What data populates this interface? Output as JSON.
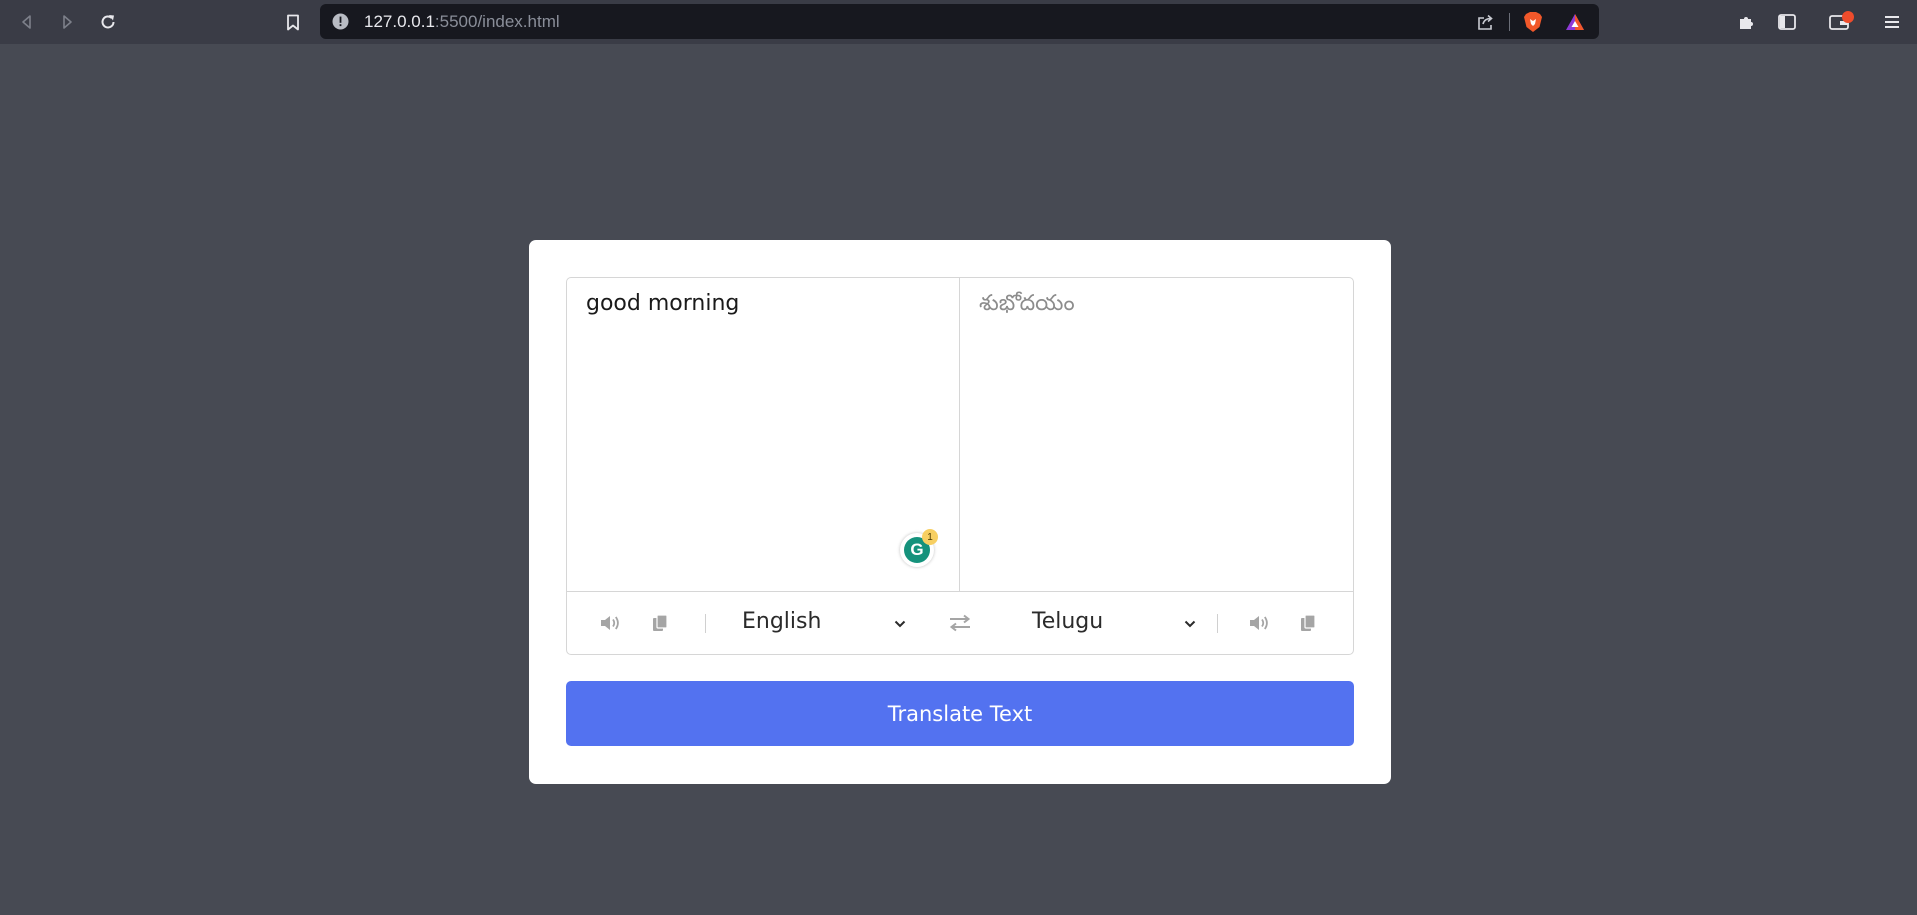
{
  "browser": {
    "url_host": "127.0.0.1",
    "url_path": ":5500/index.html",
    "icons": [
      "back-arrow-icon",
      "forward-arrow-icon",
      "reload-icon",
      "bookmark-icon",
      "site-info-icon",
      "share-icon",
      "brave-shields-icon",
      "brave-rewards-icon",
      "extensions-icon",
      "sidebar-icon",
      "wallet-icon",
      "menu-icon"
    ]
  },
  "translator": {
    "from_text": "good morning",
    "to_text": "శుభోదయం",
    "from_language": "English",
    "to_language": "Telugu",
    "button_label": "Translate Text",
    "grammarly": {
      "letter": "G",
      "count": "1"
    }
  },
  "colors": {
    "page_background": "#474a53",
    "toolbar_background": "#3a3c46",
    "urlbar_background": "#17181f",
    "card_background": "#ffffff",
    "button_accent": "#5372f0",
    "icon_gray": "#a5a5a5",
    "grammarly_green": "#15927c"
  }
}
